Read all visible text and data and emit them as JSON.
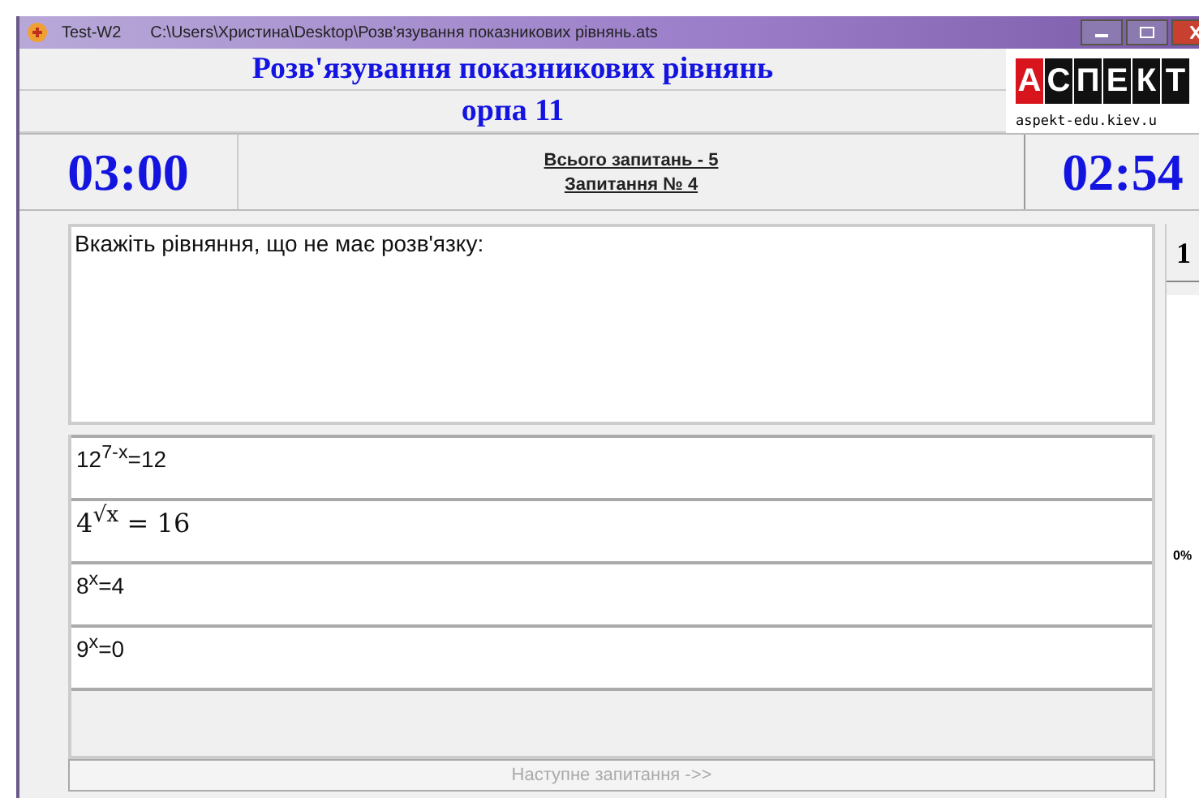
{
  "window": {
    "title": "Test-W2",
    "path": "C:\\Users\\Христина\\Desktop\\Розв'язування показникових рівнянь.ats"
  },
  "header": {
    "title": "Розв'язування показникових рівнянь",
    "subtitle": "орпа 11",
    "logo": {
      "letters": [
        {
          "letter": "А",
          "color": "#d8141c"
        },
        {
          "letter": "С",
          "color": "#111111"
        },
        {
          "letter": "П",
          "color": "#111111"
        },
        {
          "letter": "Е",
          "color": "#111111"
        },
        {
          "letter": "К",
          "color": "#111111"
        },
        {
          "letter": "Т",
          "color": "#111111"
        }
      ],
      "url": "aspekt-edu.kiev.u"
    }
  },
  "timers": {
    "total": "03:00",
    "remaining": "02:54"
  },
  "info": {
    "total_questions": "Всього запитань - 5",
    "question_number": "Запитання № 4"
  },
  "question": "Вкажіть рівняння, що не має розв'язку:",
  "answers": [
    {
      "text": "12$^{7-x}$=12",
      "kind": "plain"
    },
    {
      "text": "4$^{√x}$ = 16",
      "kind": "math"
    },
    {
      "text": "8$^{x}$=4",
      "kind": "plain"
    },
    {
      "text": "9$^{x}$=0",
      "kind": "plain"
    }
  ],
  "next_button": {
    "label": "Наступне запитання ->>",
    "disabled": true
  },
  "side": {
    "number": "1",
    "percent": "0%"
  }
}
